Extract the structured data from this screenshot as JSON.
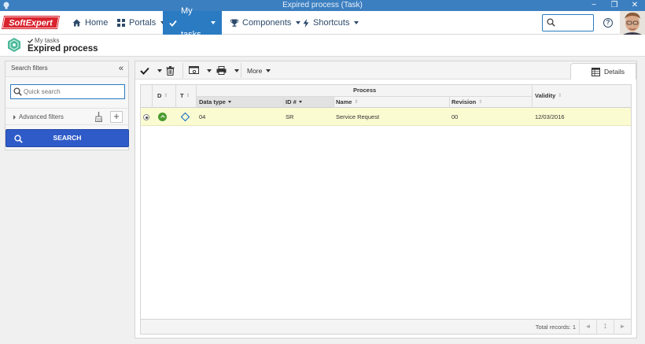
{
  "window": {
    "title": "Expired process (Task)",
    "controls": [
      "−",
      "❐",
      "✕"
    ]
  },
  "brand": {
    "logo_text": "SoftExpert"
  },
  "navbar": {
    "items": [
      {
        "label": "Home",
        "icon": "home-icon"
      },
      {
        "label": "Portals",
        "icon": "portals-icon"
      },
      {
        "label": "My tasks",
        "icon": "check-icon",
        "active": true
      },
      {
        "label": "Components",
        "icon": "trophy-icon"
      },
      {
        "label": "Shortcuts",
        "icon": "lightning-icon"
      }
    ],
    "search_placeholder": "",
    "help_glyph": "?"
  },
  "page": {
    "breadcrumb": "My tasks",
    "title": "Expired process"
  },
  "filters": {
    "header": "Search filters",
    "collapse_glyph": "«",
    "quick_search_placeholder": "Quick search",
    "advanced_label": "Advanced filters",
    "add_glyph": "+",
    "search_button": "SEARCH"
  },
  "toolbar": {
    "more_label": "More",
    "details_tab": "Details"
  },
  "table": {
    "group_header": "Process",
    "columns": {
      "d": "D",
      "t": "T",
      "data_type": "Data type",
      "id": "ID #",
      "name": "Name",
      "revision": "Revision",
      "validity": "Validity"
    },
    "rows": [
      {
        "selected": true,
        "data_type": "04",
        "id": "SR",
        "name": "Service Request",
        "revision": "00",
        "validity": "12/03/2016"
      }
    ],
    "total_records": "Total records: 1",
    "pager": {
      "prev": "◄",
      "page": "1",
      "next": "►"
    }
  },
  "colors": {
    "accent": "#2a7bc2",
    "titlebar": "#3c7fc0",
    "search_button": "#2f5bc8",
    "row_highlight": "#fbfbd2",
    "status_green": "#4a9a2e"
  }
}
